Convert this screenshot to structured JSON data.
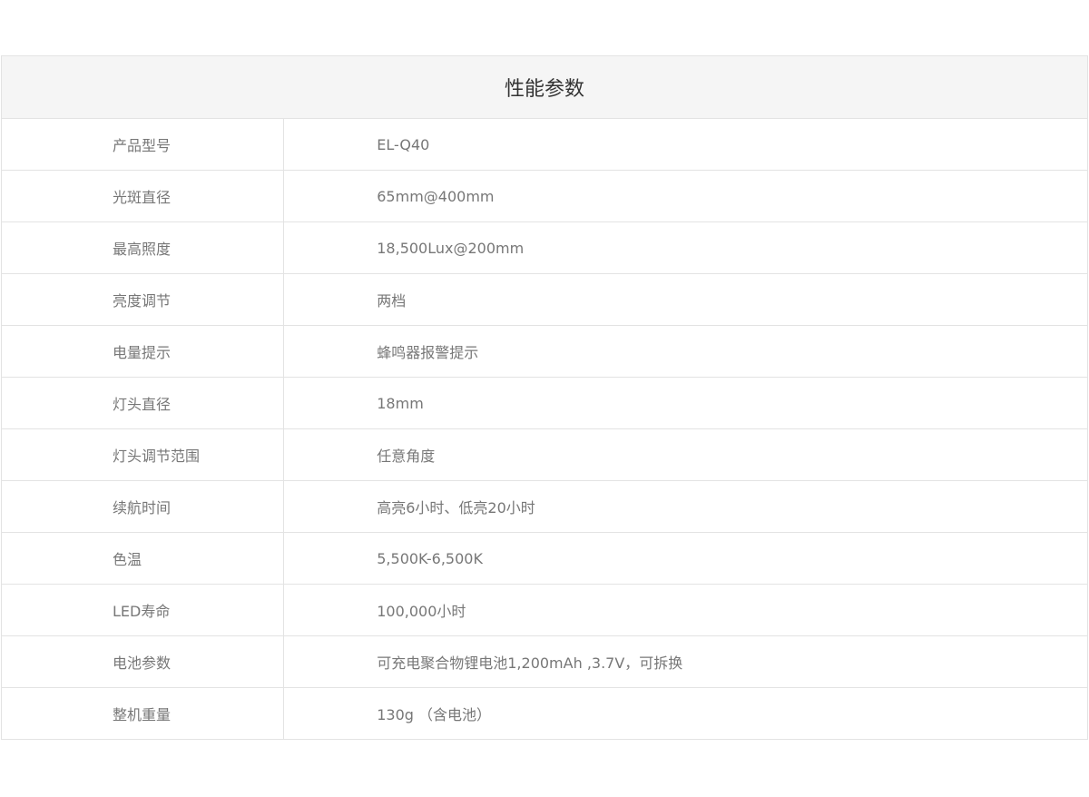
{
  "table": {
    "title": "性能参数",
    "rows": [
      {
        "label": "产品型号",
        "value": "EL-Q40"
      },
      {
        "label": "光斑直径",
        "value": "65mm@400mm"
      },
      {
        "label": "最高照度",
        "value": "18,500Lux@200mm"
      },
      {
        "label": "亮度调节",
        "value": "两档"
      },
      {
        "label": "电量提示",
        "value": "蜂鸣器报警提示"
      },
      {
        "label": "灯头直径",
        "value": "18mm"
      },
      {
        "label": "灯头调节范围",
        "value": "任意角度"
      },
      {
        "label": "续航时间",
        "value": "高亮6小时、低亮20小时"
      },
      {
        "label": "色温",
        "value": "5,500K-6,500K"
      },
      {
        "label": "LED寿命",
        "value": "100,000小时"
      },
      {
        "label": "电池参数",
        "value": "可充电聚合物锂电池1,200mAh ,3.7V，可拆换"
      },
      {
        "label": "整机重量",
        "value": "130g （含电池）"
      }
    ]
  }
}
